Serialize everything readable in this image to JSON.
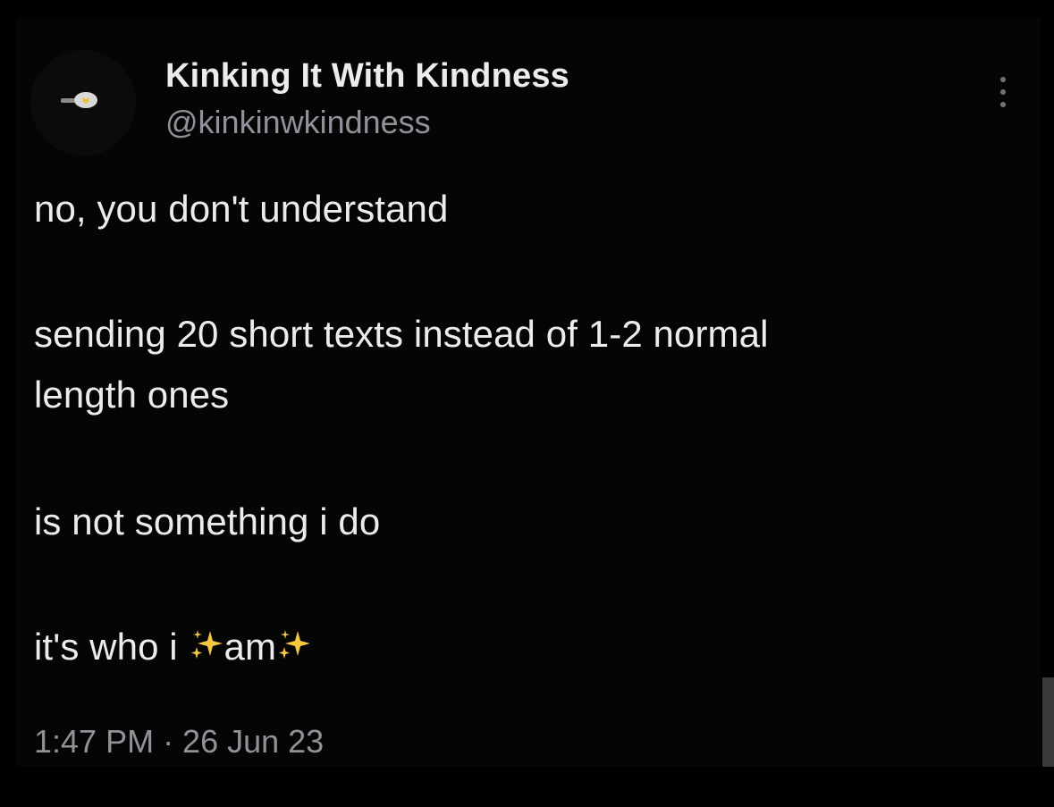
{
  "author": {
    "name": "Kinking It With Kindness",
    "handle": "@kinkinwkindness",
    "avatar_icon": "lightbulb-heart-icon"
  },
  "tweet": {
    "line1": "no, you don't understand",
    "line2": "sending 20 short texts instead of 1-2 normal",
    "line3": "length ones",
    "line4": "is not something i do",
    "line5_pre": "it's who i ",
    "line5_mid": "am",
    "sparkle_icon": "sparkles-icon",
    "sparkle_color": "#f5c842"
  },
  "timestamp": "1:47 PM · 26 Jun 23",
  "menu_icon": "more-vertical-icon",
  "colors": {
    "background": "#000000",
    "text_primary": "#ececec",
    "text_secondary": "#8f9399"
  }
}
